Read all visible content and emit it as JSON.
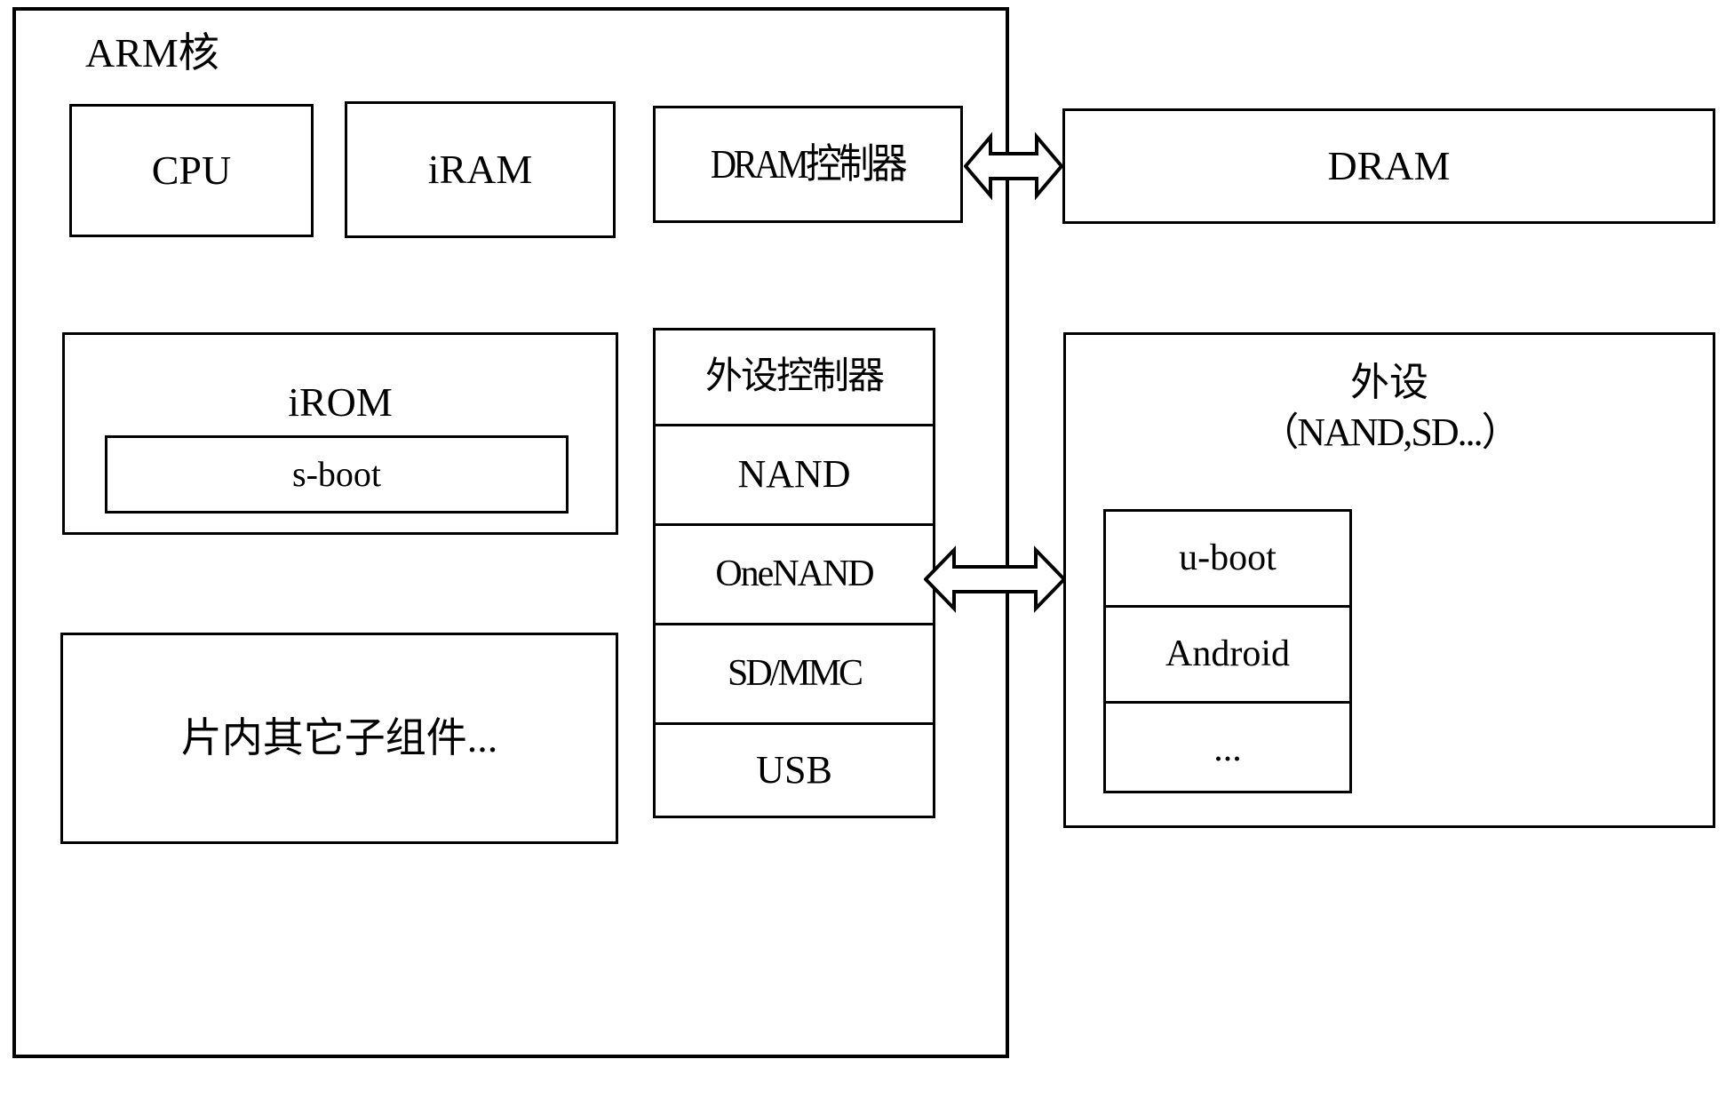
{
  "diagram": {
    "title": "ARM核",
    "arm_core": {
      "label": "ARM核",
      "cpu": "CPU",
      "iram": "iRAM",
      "dram_controller": "DRAM控制器",
      "irom": "iROM",
      "s_boot": "s-boot",
      "other_components": "片内其它子组件..."
    },
    "peripheral_controller": {
      "title": "外设控制器",
      "items": [
        {
          "label": "NAND"
        },
        {
          "label": "OneNAND"
        },
        {
          "label": "SD/MMC"
        },
        {
          "label": "USB"
        }
      ]
    },
    "dram": {
      "label": "DRAM"
    },
    "peripherals": {
      "title": "外设",
      "subtitle": "（NAND,SD...）",
      "items": [
        {
          "label": "u-boot"
        },
        {
          "label": "Android"
        },
        {
          "label": "..."
        }
      ]
    },
    "connectors": [
      {
        "name": "dram-controller-to-dram",
        "type": "double-arrow"
      },
      {
        "name": "peripheral-controller-to-peripherals",
        "type": "double-arrow"
      }
    ],
    "colors": {
      "stroke": "#000000",
      "background": "#ffffff"
    }
  }
}
